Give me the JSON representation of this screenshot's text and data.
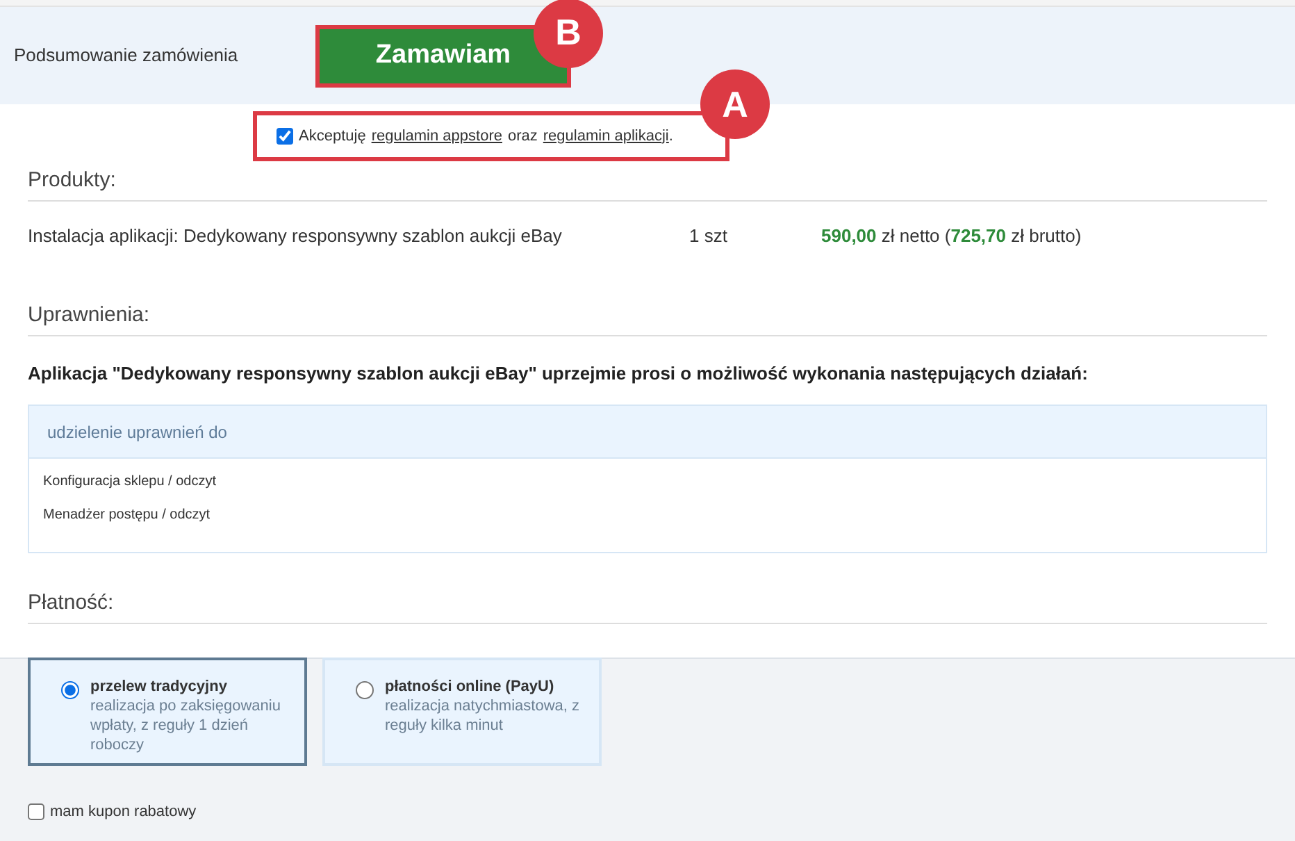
{
  "header": {
    "title": "Podsumowanie zamówienia",
    "order_button": "Zamawiam",
    "order_button_annotation": "B"
  },
  "terms": {
    "checked": true,
    "prefix": "Akceptuję",
    "link_1": "regulamin appstore",
    "middle": "oraz",
    "link_2": "regulamin aplikacji",
    "suffix": ".",
    "annotation": "A"
  },
  "products": {
    "heading": "Produkty:",
    "items": [
      {
        "name": "Instalacja aplikacji: Dedykowany responsywny szablon aukcji eBay",
        "quantity": "1 szt",
        "net": "590,00",
        "net_suffix": " zł netto (",
        "gross": "725,70",
        "gross_suffix": " zł brutto)"
      }
    ]
  },
  "permissions": {
    "heading": "Uprawnienia:",
    "intro": "Aplikacja \"Dedykowany responsywny szablon aukcji eBay\" uprzejmie prosi o możliwość wykonania następujących działań:",
    "table_header": "udzielenie uprawnień do",
    "rows": [
      "Konfiguracja sklepu / odczyt",
      "Menadżer postępu / odczyt"
    ]
  },
  "payment": {
    "heading": "Płatność:",
    "options": [
      {
        "title": "przelew tradycyjny",
        "description": "realizacja po zaksięgowaniu wpłaty, z reguły 1 dzień roboczy",
        "selected": true
      },
      {
        "title": "płatności online (PayU)",
        "description": "realizacja natychmiastowa, z reguły kilka minut",
        "selected": false
      }
    ],
    "coupon": {
      "label": "mam kupon rabatowy",
      "checked": false
    }
  }
}
